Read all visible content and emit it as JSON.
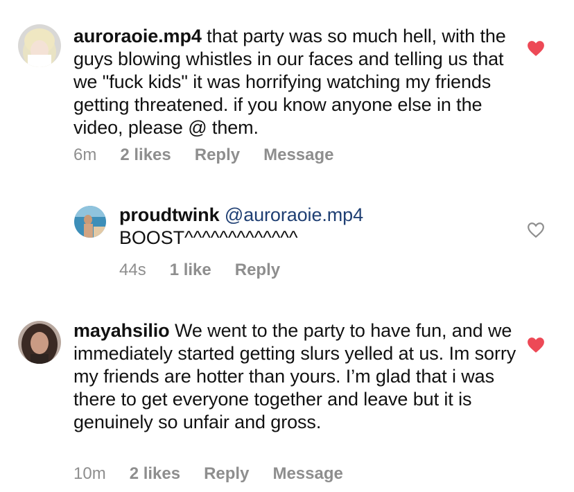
{
  "comments": [
    {
      "username": "auroraoie.mp4",
      "text": "that party was so much hell, with the guys blowing whistles in our faces and telling us that we \"fuck kids\" it was horrifying watching my friends getting threatened. if you know anyone else in the video, please @ them.",
      "time": "6m",
      "likes": "2 likes",
      "reply_label": "Reply",
      "message_label": "Message",
      "liked": true
    },
    {
      "username": "proudtwink",
      "mention": "@auroraoie.mp4",
      "text": "BOOST^^^^^^^^^^^^^",
      "time": "44s",
      "likes": "1 like",
      "reply_label": "Reply",
      "liked": false
    },
    {
      "username": "mayahsilio",
      "text": "We went to the party to have fun, and we immediately started getting slurs yelled at us. Im sorry my friends are hotter than yours. I’m glad that i was there to get everyone together and leave but it is genuinely so unfair and gross.",
      "time": "10m",
      "likes": "2 likes",
      "reply_label": "Reply",
      "message_label": "Message",
      "liked": true
    }
  ],
  "colors": {
    "heart_liked": "#ed4956",
    "heart_outline": "#8e8e8e",
    "meta_text": "#8e8e8e",
    "mention": "#1f3f73"
  },
  "icons": {
    "liked": "heart-filled-icon",
    "unliked": "heart-outline-icon"
  }
}
